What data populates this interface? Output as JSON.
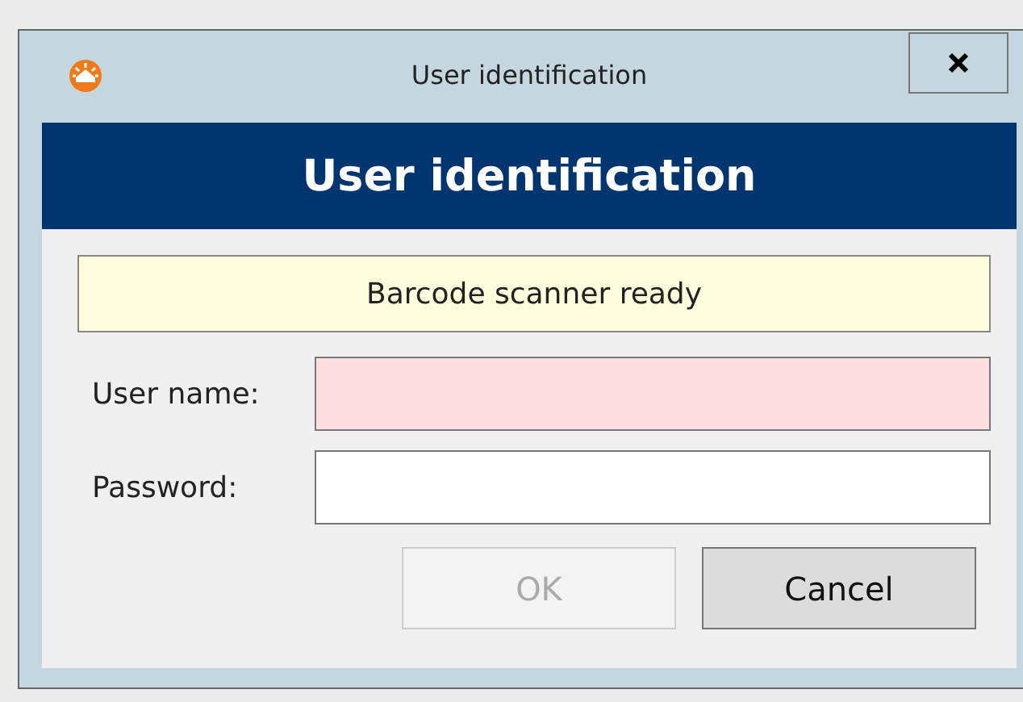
{
  "window": {
    "title": "User identification"
  },
  "header": {
    "title": "User identification"
  },
  "status": {
    "message": "Barcode scanner ready"
  },
  "fields": [
    {
      "label": "User name:",
      "invalid": true
    },
    {
      "label": "Password:",
      "invalid": false
    }
  ],
  "buttons": [
    {
      "label": "OK",
      "disabled": true
    },
    {
      "label": "Cancel",
      "disabled": false
    }
  ]
}
